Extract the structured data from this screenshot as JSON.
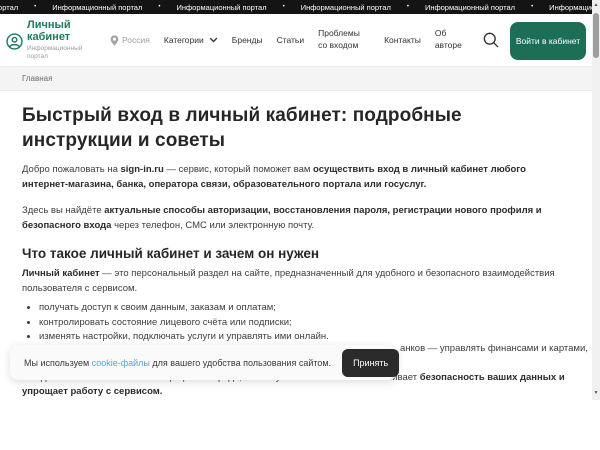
{
  "ticker": {
    "label": "Информационный портал",
    "separator": "•"
  },
  "header": {
    "logo": {
      "title": "Личный кабинет",
      "subtitle": "Информационный портал"
    },
    "nav": {
      "location": "Россия",
      "categories": "Категории",
      "brands": "Бренды",
      "articles": "Статьи",
      "login_problems": "Проблемы со входом",
      "contacts": "Контакты",
      "about": "Об авторе"
    },
    "login_button": "Войти в кабинет"
  },
  "breadcrumb": {
    "home": "Главная"
  },
  "article": {
    "h1": "Быстрый вход в личный кабинет: подробные инструкции и советы",
    "p1": [
      {
        "t": "Добро пожаловать на "
      },
      {
        "t": "sign-in.ru"
      },
      {
        "t": " — сервис, который поможет вам "
      },
      {
        "t": "осуществить вход в личный кабинет любого интернет-магазина, банка, оператора связи, образовательного портала или госуслуг."
      }
    ],
    "p2": [
      {
        "t": "Здесь вы найдёте "
      },
      {
        "t": "актуальные способы авторизации, восстановления пароля, регистрации нового профиля и безопасного входа"
      },
      {
        "t": " через телефон, СМС или электронную почту."
      }
    ],
    "h2": "Что такое личный кабинет и зачем он нужен",
    "p3": [
      {
        "t": "Личный кабинет"
      },
      {
        "t": " — это персональный раздел на сайте, предназначенный для удобного и безопасного взаимодействия пользователя с сервисом."
      }
    ],
    "bullets": [
      "получать доступ к своим данным, заказам и оплатам;",
      "контролировать состояние лицевого счёта или подписки;",
      "изменять настройки, подключать услуги и управлять ими онлайн."
    ],
    "p4_fragment": "анков — управлять финансами и картами,",
    "p5": [
      {
        "t": "Все действия выполняются в защищенной среде, поэтому личный кабинет обеспечивает "
      },
      {
        "t": "безопасность ваших данных и упрощает работу с сервисом."
      }
    ]
  },
  "cookie_banner": {
    "text_before": "Мы используем ",
    "link": "cookie-файлы",
    "text_after": " для вашего удобства пользования сайтом.",
    "accept_button": "Принять"
  },
  "colors": {
    "accent_green": "#1d6e57",
    "link_blue": "#57a3e4",
    "ticker_bg": "#141414",
    "accept_btn_bg": "#2b2b2b"
  }
}
